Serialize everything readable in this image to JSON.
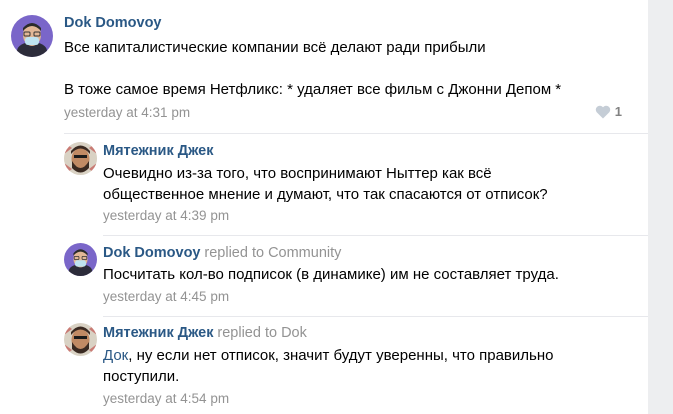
{
  "post": {
    "author": "Dok Domovoy",
    "text_line1": "Все капиталистические компании всё делают ради прибыли",
    "text_line2": "В тоже самое время Нетфликс: * удаляет все фильм с Джонни Депом *",
    "time": "yesterday at 4:31 pm",
    "like_count": "1"
  },
  "comments": [
    {
      "author": "Мятежник Джек",
      "replied": "",
      "text_line1": "Очевидно из-за того, что воспринимают Ныттер как всё",
      "text_line2": "общественное мнение и думают, что так спасаются от отписок?",
      "time": "yesterday at 4:39 pm"
    },
    {
      "author": "Dok Domovoy",
      "replied": "replied to Community",
      "text_line1": "Посчитать кол-во подписок (в динамике) им не составляет труда.",
      "time": "yesterday at 4:45 pm"
    },
    {
      "author": "Мятежник Джек",
      "replied": "replied to Dok",
      "mention": "Док",
      "text_line1_rest": ", ну если нет отписок, значит будут уверенны, что правильно",
      "text_line2": "поступили.",
      "time": "yesterday at 4:54 pm"
    }
  ],
  "icons": {
    "like": "heart-icon",
    "avatar_dok": "avatar-masked-man",
    "avatar_jack": "avatar-bearded-man"
  },
  "colors": {
    "link": "#2a5885",
    "meta": "#939393",
    "divider": "#e7e8ec",
    "background": "#edeef0"
  }
}
